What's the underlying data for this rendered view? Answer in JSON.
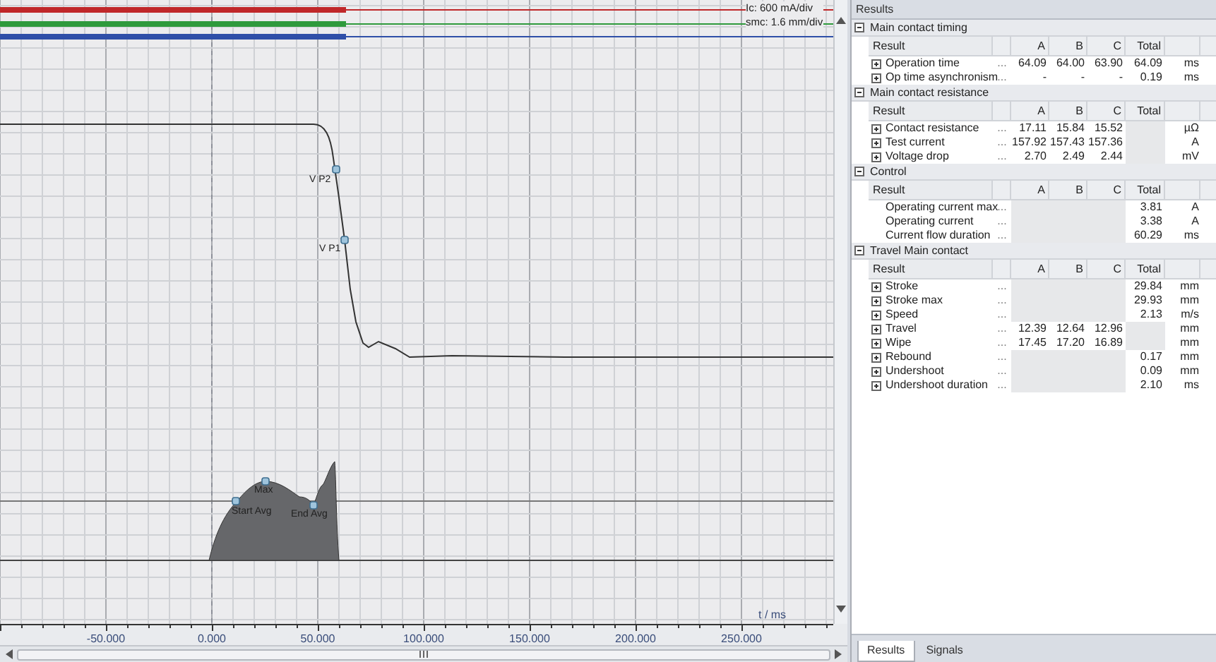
{
  "chart": {
    "scales": [
      "Ic: 600 mA/div",
      "smc: 1.6 mm/div"
    ],
    "markers": [
      {
        "label": "V P2"
      },
      {
        "label": "V P1"
      },
      {
        "label": "Max"
      },
      {
        "label": "Start Avg"
      },
      {
        "label": "End Avg"
      }
    ],
    "x_axis": {
      "label": "t / ms",
      "ticks": [
        "-50.000",
        "0.000",
        "50.000",
        "100.000",
        "150.000",
        "200.000",
        "250.000"
      ]
    }
  },
  "results": {
    "title": "Results",
    "groups": [
      {
        "title": "Main contact timing",
        "expanded": true,
        "columns": [
          "Result",
          "A",
          "B",
          "C",
          "Total"
        ],
        "rows": [
          {
            "name": "Operation time",
            "expandable": true,
            "more": "...",
            "values": [
              "64.09",
              "64.00",
              "63.90"
            ],
            "total": "64.09",
            "unit": "ms"
          },
          {
            "name": "Op time asynchronism",
            "expandable": true,
            "more": "...",
            "values": [
              "-",
              "-",
              "-"
            ],
            "total": "0.19",
            "unit": "ms"
          }
        ]
      },
      {
        "title": "Main contact resistance",
        "expanded": true,
        "columns": [
          "Result",
          "A",
          "B",
          "C",
          "Total"
        ],
        "rows": [
          {
            "name": "Contact resistance",
            "expandable": true,
            "more": "...",
            "values": [
              "17.11",
              "15.84",
              "15.52"
            ],
            "unit": "µΩ"
          },
          {
            "name": "Test current",
            "expandable": true,
            "more": "...",
            "values": [
              "157.92",
              "157.43",
              "157.36"
            ],
            "unit": "A"
          },
          {
            "name": "Voltage drop",
            "expandable": true,
            "more": "...",
            "values": [
              "2.70",
              "2.49",
              "2.44"
            ],
            "unit": "mV"
          }
        ]
      },
      {
        "title": "Control",
        "expanded": true,
        "columns": [
          "Result",
          "A",
          "B",
          "C",
          "Total"
        ],
        "rows": [
          {
            "name": "Operating current max",
            "expandable": false,
            "more": "...",
            "total": "3.81",
            "unit": "A"
          },
          {
            "name": "Operating current",
            "expandable": false,
            "more": "...",
            "total": "3.38",
            "unit": "A"
          },
          {
            "name": "Current flow duration",
            "expandable": false,
            "more": "...",
            "total": "60.29",
            "unit": "ms"
          }
        ]
      },
      {
        "title": "Travel Main contact",
        "expanded": true,
        "columns": [
          "Result",
          "A",
          "B",
          "C",
          "Total"
        ],
        "rows": [
          {
            "name": "Stroke",
            "expandable": true,
            "more": "...",
            "total": "29.84",
            "unit": "mm"
          },
          {
            "name": "Stroke max",
            "expandable": true,
            "more": "...",
            "total": "29.93",
            "unit": "mm"
          },
          {
            "name": "Speed",
            "expandable": true,
            "more": "...",
            "total": "2.13",
            "unit": "m/s"
          },
          {
            "name": "Travel",
            "expandable": true,
            "more": "...",
            "values": [
              "12.39",
              "12.64",
              "12.96"
            ],
            "unit": "mm"
          },
          {
            "name": "Wipe",
            "expandable": true,
            "more": "...",
            "values": [
              "17.45",
              "17.20",
              "16.89"
            ],
            "unit": "mm"
          },
          {
            "name": "Rebound",
            "expandable": true,
            "more": "...",
            "total": "0.17",
            "unit": "mm"
          },
          {
            "name": "Undershoot",
            "expandable": true,
            "more": "...",
            "total": "0.09",
            "unit": "mm"
          },
          {
            "name": "Undershoot duration",
            "expandable": true,
            "more": "...",
            "total": "2.10",
            "unit": "ms"
          }
        ]
      }
    ]
  },
  "tabs": [
    {
      "label": "Results",
      "selected": true
    },
    {
      "label": "Signals",
      "selected": false
    }
  ]
}
